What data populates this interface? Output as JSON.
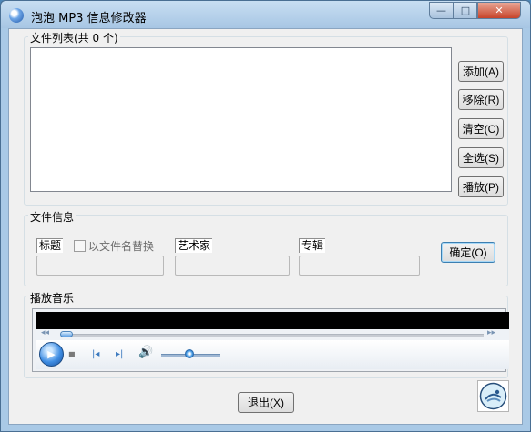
{
  "window": {
    "title": "泡泡 MP3 信息修改器",
    "controls": {
      "minimize": "—",
      "maximize": "□",
      "close": "✕"
    }
  },
  "file_list": {
    "label": "文件列表(共 0 个)",
    "buttons": [
      "添加(A)",
      "移除(R)",
      "清空(C)",
      "全选(S)",
      "播放(P)"
    ]
  },
  "file_info": {
    "label": "文件信息",
    "title_label": "标题",
    "replace_checkbox": "以文件名替换",
    "artist_label": "艺术家",
    "album_label": "专辑",
    "confirm_button": "确定(O)"
  },
  "player": {
    "label": "播放音乐",
    "seek_back": "◂◂",
    "seek_forward": "▸▸",
    "play": "▶",
    "stop": "■",
    "prev": "|◂",
    "next": "▸|",
    "volume": "🔊"
  },
  "footer": {
    "exit_button": "退出(X)"
  }
}
